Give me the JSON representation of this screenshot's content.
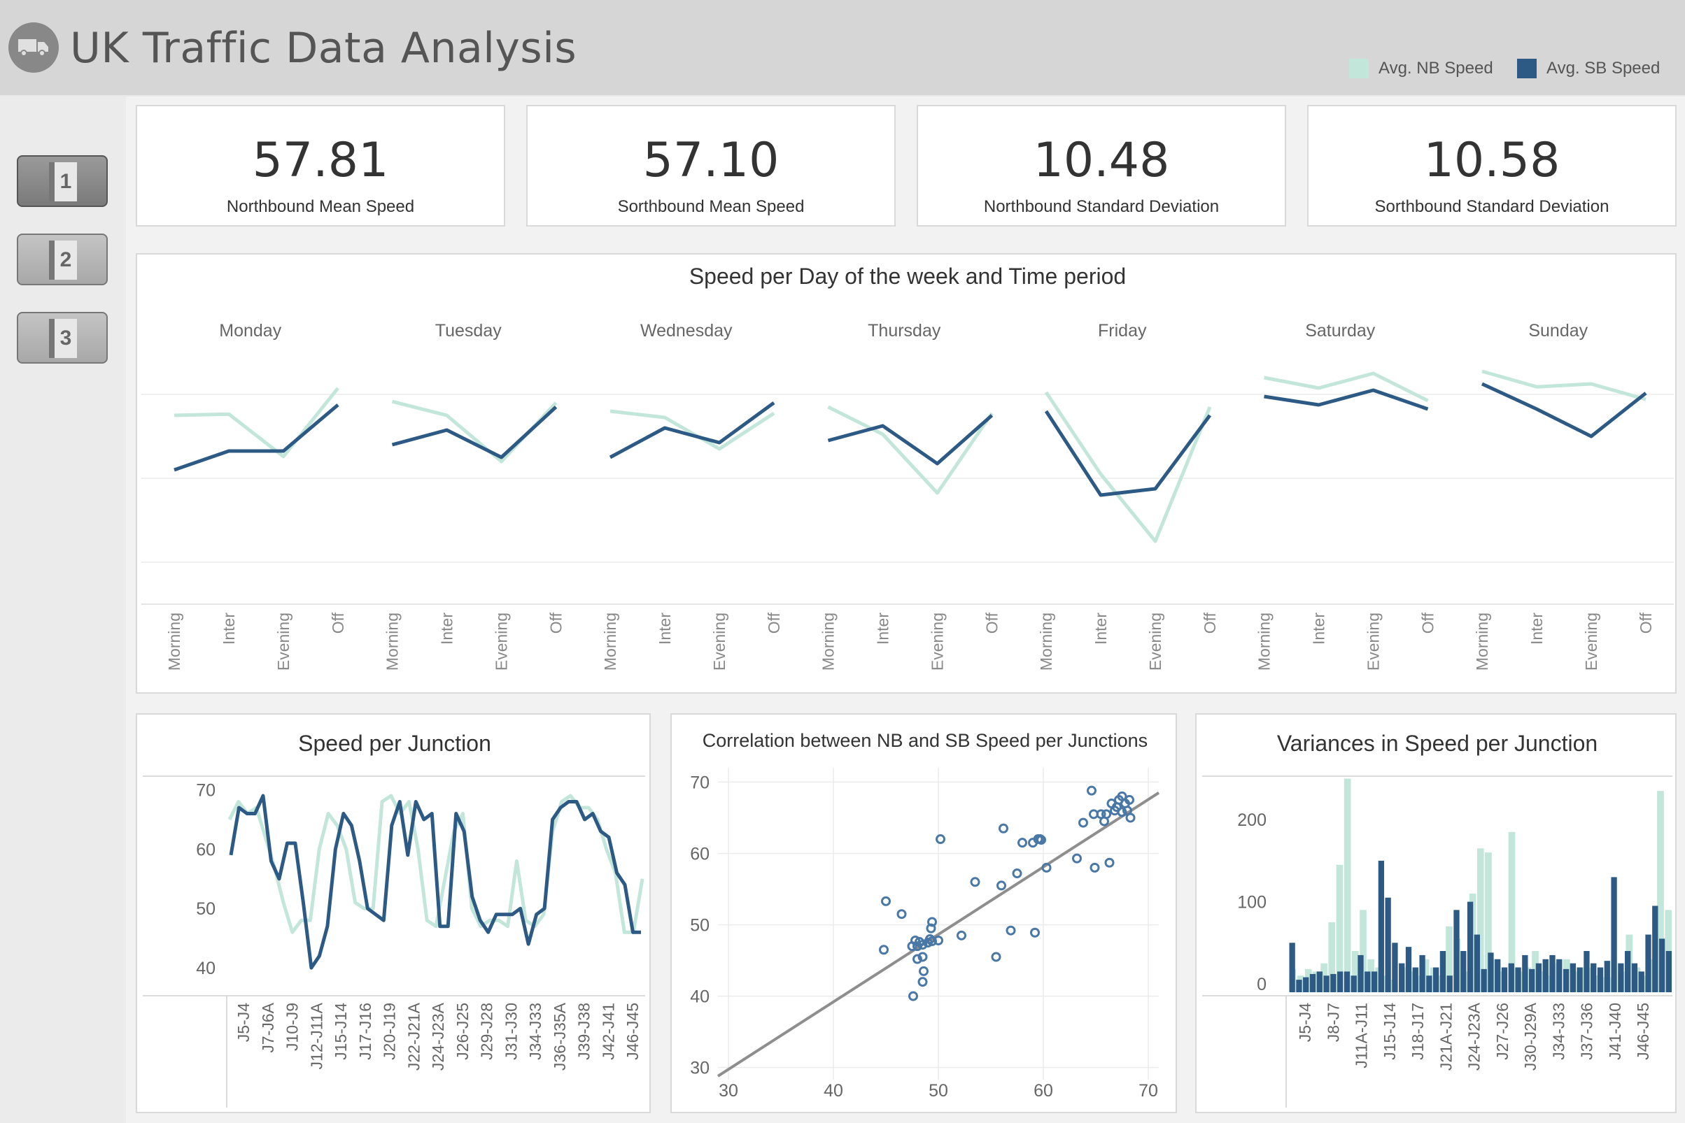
{
  "header": {
    "title": "UK Traffic Data Analysis",
    "logo_icon": "truck-icon",
    "legend": [
      {
        "label": "Avg. NB Speed",
        "color": "#c3e6da"
      },
      {
        "label": "Avg. SB Speed",
        "color": "#2c5a84"
      }
    ]
  },
  "sidebar": {
    "pages": [
      {
        "label": "1",
        "selected": true
      },
      {
        "label": "2",
        "selected": false
      },
      {
        "label": "3",
        "selected": false
      }
    ]
  },
  "kpis": [
    {
      "value": "57.81",
      "label": "Northbound Mean Speed"
    },
    {
      "value": "57.10",
      "label": "Sorthbound Mean Speed"
    },
    {
      "value": "10.48",
      "label": "Northbound Standard Deviation"
    },
    {
      "value": "10.58",
      "label": "Sorthbound Standard Deviation"
    }
  ],
  "colors": {
    "nb": "#c3e6da",
    "sb": "#2c5a84",
    "trend": "#8e8e8e",
    "grid": "#ebebeb"
  },
  "chart_data": [
    {
      "type": "line",
      "title": "Speed per Day of the week and Time period",
      "panels": [
        "Monday",
        "Tuesday",
        "Wednesday",
        "Thursday",
        "Friday",
        "Saturday",
        "Sunday"
      ],
      "categories": [
        "Morning",
        "Inter",
        "Evening",
        "Off"
      ],
      "ylim": [
        20,
        80
      ],
      "grid": true,
      "series": [
        {
          "name": "Avg. NB Speed",
          "values": [
            [
              65,
              65.3,
              55.2,
              71.5
            ],
            [
              68.3,
              65,
              54,
              68
            ],
            [
              66,
              64.5,
              57,
              65.5
            ],
            [
              67,
              60.5,
              46.5,
              65.5
            ],
            [
              70.5,
              51,
              35,
              67
            ],
            [
              74,
              71.5,
              75,
              68.5
            ],
            [
              75.5,
              71.8,
              72.5,
              68.8
            ]
          ]
        },
        {
          "name": "Avg. SB Speed",
          "values": [
            [
              52,
              56.5,
              56.5,
              67.5
            ],
            [
              58,
              61.5,
              55,
              67
            ],
            [
              55,
              62,
              58.5,
              68
            ],
            [
              59,
              62.5,
              53.5,
              65
            ],
            [
              66,
              46,
              47.5,
              65
            ],
            [
              69.5,
              67.5,
              71,
              66.5
            ],
            [
              72.5,
              66.5,
              60,
              70.3
            ]
          ]
        }
      ]
    },
    {
      "type": "line",
      "title": "Speed per Junction",
      "categories": [
        "J5-J4",
        "J7-J6A",
        "J10-J9",
        "J12-J11A",
        "J15-J14",
        "J17-J16",
        "J20-J19",
        "J22-J21A",
        "J24-J23A",
        "J26-J25",
        "J29-J28",
        "J31-J30",
        "J34-J33",
        "J36-J35A",
        "J39-J38",
        "J42-J41",
        "J46-J45"
      ],
      "yticks": [
        40,
        50,
        60,
        70
      ],
      "ylim": [
        35.3,
        72.3
      ],
      "series": [
        {
          "name": "Avg. NB Speed",
          "values": [
            65,
            68,
            66,
            67,
            62,
            57,
            51,
            46,
            48,
            48,
            60,
            66,
            64,
            60,
            51,
            50,
            50,
            68,
            69,
            66,
            68,
            60,
            48,
            47,
            55,
            63,
            66,
            50,
            47,
            48,
            48,
            47,
            58,
            48,
            47,
            49,
            63,
            68,
            69,
            67,
            67,
            65,
            60,
            56,
            46,
            46,
            55
          ]
        },
        {
          "name": "Avg. SB Speed",
          "values": [
            59,
            67,
            66,
            66,
            69,
            58,
            55,
            61,
            61,
            51,
            40,
            42,
            47,
            60,
            66,
            64,
            58,
            50,
            49,
            48,
            64,
            68,
            59,
            68,
            65,
            66,
            47,
            47,
            66,
            63,
            52,
            48,
            46,
            49,
            49,
            49,
            50,
            44,
            49,
            50,
            65,
            67,
            68,
            68,
            65,
            66,
            63,
            62,
            56,
            54,
            46,
            46
          ]
        }
      ]
    },
    {
      "type": "scatter",
      "title": "Correlation between NB and SB Speed per Junctions",
      "xlim": [
        29,
        71
      ],
      "ylim": [
        28.3,
        72
      ],
      "xticks": [
        30,
        40,
        50,
        60,
        70
      ],
      "yticks": [
        30,
        40,
        50,
        60,
        70
      ],
      "trendline": [
        [
          29,
          28.8
        ],
        [
          71,
          68.5
        ]
      ],
      "points": [
        [
          45,
          53.3
        ],
        [
          46.5,
          51.5
        ],
        [
          47.5,
          47
        ],
        [
          47.8,
          47.8
        ],
        [
          48,
          47
        ],
        [
          48,
          45.2
        ],
        [
          48.2,
          47.6
        ],
        [
          48.5,
          47.2
        ],
        [
          48.5,
          45.5
        ],
        [
          48.6,
          43.5
        ],
        [
          48.5,
          42
        ],
        [
          47.6,
          40
        ],
        [
          44.8,
          46.5
        ],
        [
          49,
          47.5
        ],
        [
          49.2,
          48
        ],
        [
          49.3,
          49.5
        ],
        [
          49.4,
          50.4
        ],
        [
          49.4,
          47.7
        ],
        [
          50,
          47.8
        ],
        [
          50.2,
          62
        ],
        [
          52.2,
          48.5
        ],
        [
          53.5,
          56
        ],
        [
          55.5,
          45.5
        ],
        [
          56,
          55.5
        ],
        [
          56.2,
          63.5
        ],
        [
          56.9,
          49.2
        ],
        [
          57.5,
          57.2
        ],
        [
          58,
          61.5
        ],
        [
          59,
          61.5
        ],
        [
          59.5,
          62
        ],
        [
          59.7,
          62
        ],
        [
          59.8,
          61.9
        ],
        [
          59.2,
          48.9
        ],
        [
          60.3,
          58
        ],
        [
          63.2,
          59.3
        ],
        [
          63.8,
          64.3
        ],
        [
          64.6,
          68.8
        ],
        [
          64.8,
          65.5
        ],
        [
          64.9,
          58
        ],
        [
          65.5,
          65.5
        ],
        [
          65.8,
          64.5
        ],
        [
          66,
          65.5
        ],
        [
          66.3,
          58.7
        ],
        [
          66.5,
          67
        ],
        [
          66.8,
          66
        ],
        [
          67,
          66.5
        ],
        [
          67.2,
          67.5
        ],
        [
          67.5,
          68
        ],
        [
          67.5,
          65.8
        ],
        [
          67.8,
          67
        ],
        [
          68,
          66
        ],
        [
          68.2,
          67.5
        ],
        [
          68.3,
          65
        ]
      ]
    },
    {
      "type": "bar",
      "title": "Variances in Speed per Junction",
      "categories": [
        "J5-J4",
        "J8-J7",
        "J11A-J11",
        "J15-J14",
        "J18-J17",
        "J21A-J21",
        "J24-J23A",
        "J27-J26",
        "J30-J29A",
        "J34-J33",
        "J37-J36",
        "J41-J40",
        "J46-J45"
      ],
      "yticks": [
        0,
        100,
        200
      ],
      "ylim": [
        -14.5,
        253
      ],
      "series": [
        {
          "name": "Avg. NB Speed",
          "values": [
            18,
            10,
            18,
            15,
            25,
            75,
            145,
            250,
            40,
            90,
            30,
            20,
            10,
            5,
            20,
            15,
            10,
            30,
            20,
            10,
            70,
            55,
            15,
            110,
            165,
            160,
            30,
            15,
            185,
            15,
            20,
            40,
            15,
            10,
            25,
            30,
            15,
            20,
            20,
            10,
            8,
            8,
            15,
            60,
            20,
            10,
            30,
            235,
            90
          ]
        },
        {
          "name": "Avg. SB Speed",
          "values": [
            50,
            5,
            8,
            12,
            15,
            10,
            12,
            15,
            15,
            10,
            35,
            15,
            15,
            150,
            105,
            50,
            25,
            45,
            20,
            35,
            10,
            20,
            40,
            10,
            90,
            40,
            100,
            60,
            18,
            38,
            30,
            20,
            25,
            20,
            35,
            18,
            25,
            30,
            35,
            30,
            18,
            25,
            20,
            40,
            25,
            20,
            28,
            130,
            25,
            40,
            25,
            15,
            60,
            95,
            55,
            40
          ]
        }
      ]
    }
  ]
}
